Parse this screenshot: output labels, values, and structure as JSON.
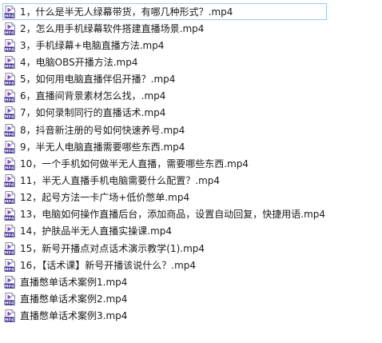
{
  "file_list": {
    "selected_index": 0,
    "icon": "mp4-video-file-icon",
    "colors": {
      "selection_border": "#99c9ef",
      "icon_badge": "#3a2a8c",
      "icon_play": "#7b4fd6"
    },
    "items": [
      {
        "name": "1，什么是半无人绿幕带货，有哪几种形式？.mp4"
      },
      {
        "name": "2，怎么用手机绿幕软件搭建直播场景.mp4"
      },
      {
        "name": "3，手机绿幕+电脑直播方法.mp4"
      },
      {
        "name": "4，电脑OBS开播方法.mp4"
      },
      {
        "name": "5，如何用电脑直播伴侣开播？.mp4"
      },
      {
        "name": "6，直播间背景素材怎么找，.mp4"
      },
      {
        "name": "7，如何录制同行的直播话术.mp4"
      },
      {
        "name": "8，抖音新注册的号如何快速养号.mp4"
      },
      {
        "name": "9，半无人电脑直播需要哪些东西.mp4"
      },
      {
        "name": "10，一个手机如何做半无人直播，需要哪些东西.mp4"
      },
      {
        "name": "11，半无人直播手机电脑需要什么配置？.mp4"
      },
      {
        "name": "12，起号方法一卡广场+低价憋单.mp4"
      },
      {
        "name": "13，电脑如何操作直播后台，添加商品，设置自动回复，快捷用语.mp4"
      },
      {
        "name": "14，护肤品半无人直播实操课.mp4"
      },
      {
        "name": "15，新号开播点对点话术演示教学(1).mp4"
      },
      {
        "name": "16，【话术课】新号开播该说什么？.mp4"
      },
      {
        "name": "直播憋单话术案例1.mp4"
      },
      {
        "name": "直播憋单话术案例2.mp4"
      },
      {
        "name": "直播憋单话术案例3.mp4"
      }
    ]
  }
}
